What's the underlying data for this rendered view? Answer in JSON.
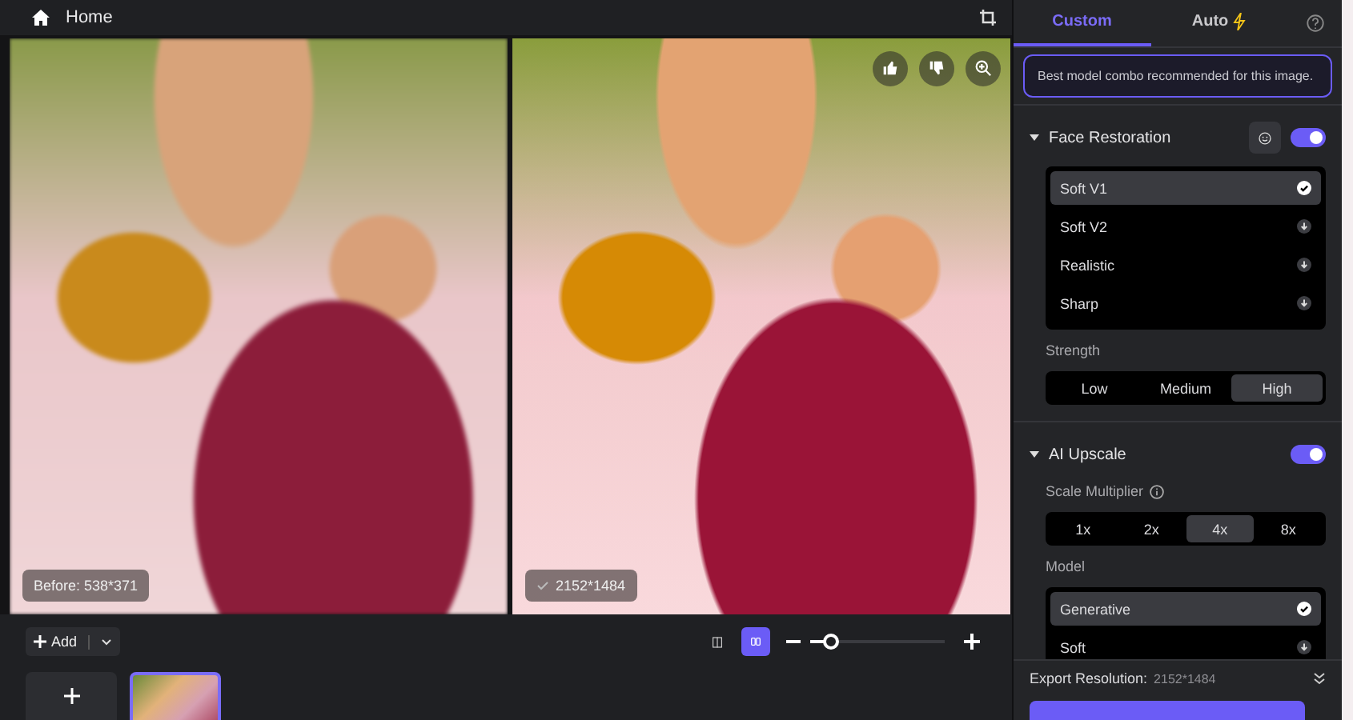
{
  "topbar": {
    "title": "Home"
  },
  "compare": {
    "before_label": "Before: 538*371",
    "after_label": "2152*1484"
  },
  "toolbar": {
    "add_label": "Add",
    "view_modes": [
      {
        "kind": "split",
        "selected": false
      },
      {
        "kind": "side",
        "selected": true
      }
    ],
    "zoom": {
      "level": 0.15
    }
  },
  "panel": {
    "tabs": [
      {
        "label": "Custom",
        "selected": true,
        "kind": "plain"
      },
      {
        "label": "Auto",
        "selected": false,
        "kind": "bolt"
      }
    ],
    "notice": "Best model combo recommended for this image.",
    "face_restoration": {
      "title": "Face Restoration",
      "expanded": true,
      "on": true,
      "models": [
        {
          "label": "Soft V1",
          "selected": true
        },
        {
          "label": "Soft V2",
          "selected": false
        },
        {
          "label": "Realistic",
          "selected": false
        },
        {
          "label": "Sharp",
          "selected": false
        }
      ],
      "strength_label": "Strength",
      "strength": [
        {
          "label": "Low",
          "selected": false
        },
        {
          "label": "Medium",
          "selected": false
        },
        {
          "label": "High",
          "selected": true
        }
      ]
    },
    "ai_upscale": {
      "title": "AI Upscale",
      "expanded": true,
      "on": true,
      "scale_label": "Scale Multiplier",
      "scales": [
        {
          "label": "1x",
          "selected": false
        },
        {
          "label": "2x",
          "selected": false
        },
        {
          "label": "4x",
          "selected": true
        },
        {
          "label": "8x",
          "selected": false
        }
      ],
      "model_label": "Model",
      "models": [
        {
          "label": "Generative",
          "selected": true
        },
        {
          "label": "Soft",
          "selected": false
        }
      ]
    },
    "export": {
      "label": "Export Resolution:",
      "value": "2152*1484"
    }
  }
}
